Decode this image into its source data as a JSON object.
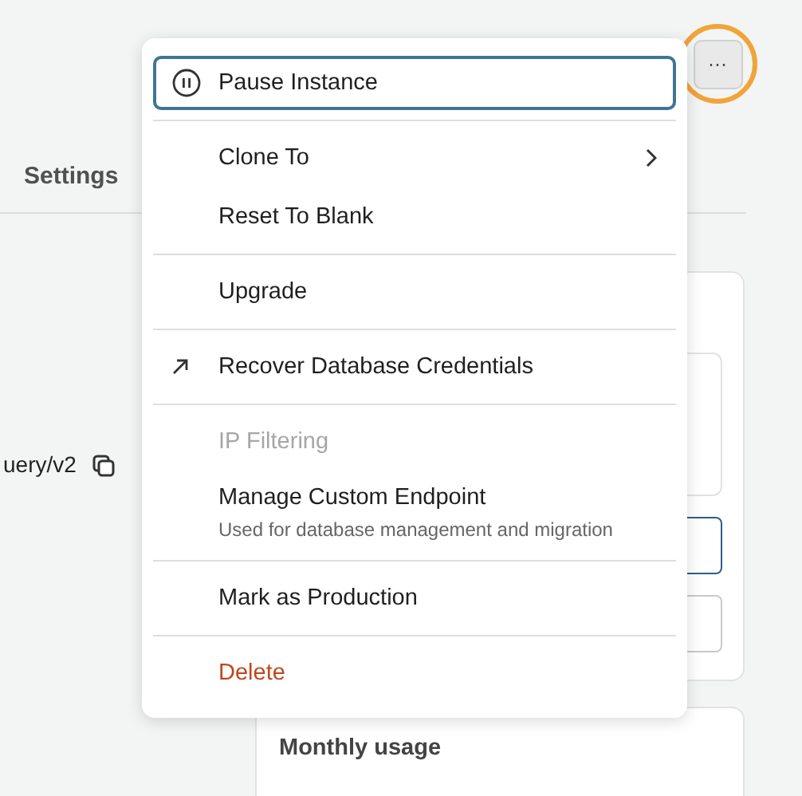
{
  "page": {
    "tab_label": "Settings",
    "endpoint_fragment": "uery/v2",
    "usage_card_title": "Monthly usage"
  },
  "more_button": {
    "label": "···",
    "highlighted": true
  },
  "menu": {
    "groups": [
      [
        {
          "label": "Pause Instance",
          "kind": "pause",
          "focused": true,
          "disabled": false
        }
      ],
      [
        {
          "label": "Clone To",
          "kind": "submenu",
          "focused": false,
          "disabled": false
        },
        {
          "label": "Reset To Blank",
          "kind": "plain",
          "focused": false,
          "disabled": false
        }
      ],
      [
        {
          "label": "Upgrade",
          "kind": "plain",
          "focused": false,
          "disabled": false
        }
      ],
      [
        {
          "label": "Recover Database Credentials",
          "kind": "external",
          "focused": false,
          "disabled": false
        }
      ],
      [
        {
          "label": "IP Filtering",
          "kind": "plain",
          "focused": false,
          "disabled": true
        },
        {
          "label": "Manage Custom Endpoint",
          "kind": "plain",
          "focused": false,
          "disabled": false,
          "description": "Used for database management and migration"
        }
      ],
      [
        {
          "label": "Mark as Production",
          "kind": "plain",
          "focused": false,
          "disabled": false
        }
      ],
      [
        {
          "label": "Delete",
          "kind": "danger",
          "focused": false,
          "disabled": false
        }
      ]
    ]
  }
}
